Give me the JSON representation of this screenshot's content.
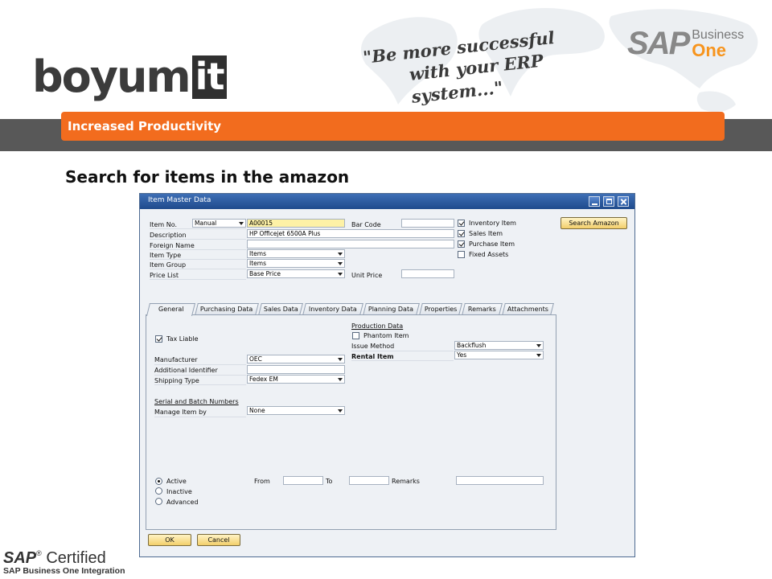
{
  "branding": {
    "logo_text": "boyum",
    "logo_box_text": "it",
    "slogan_line1": "\"Be more successful",
    "slogan_line2": "with your ERP system...\"",
    "sap_logo_text": "SAP",
    "sap_business": "Business",
    "sap_one": "One",
    "certified_line1": "SAP",
    "certified_line1b": "Certified",
    "certified_line2": "SAP Business One Integration"
  },
  "header": {
    "band_title": "Increased Productivity",
    "slide_heading": "Search for items in the amazon"
  },
  "window": {
    "title": "Item Master Data",
    "labels": {
      "item_no": "Item No.",
      "description": "Description",
      "foreign_name": "Foreign Name",
      "item_type": "Item Type",
      "item_group": "Item Group",
      "price_list": "Price List",
      "bar_code": "Bar Code",
      "unit_price": "Unit Price"
    },
    "values": {
      "numbering": "Manual",
      "item_no": "A00015",
      "description": "HP Officejet 6500A Plus",
      "foreign_name": "",
      "item_type": "Items",
      "item_group": "Items",
      "price_list": "Base Price",
      "bar_code": "",
      "unit_price": ""
    },
    "flags": [
      {
        "label": "Inventory Item",
        "checked": true
      },
      {
        "label": "Sales Item",
        "checked": true
      },
      {
        "label": "Purchase Item",
        "checked": true
      },
      {
        "label": "Fixed Assets",
        "checked": false
      }
    ],
    "search_button": "Search Amazon",
    "tabs": [
      "General",
      "Purchasing Data",
      "Sales Data",
      "Inventory Data",
      "Planning Data",
      "Properties",
      "Remarks",
      "Attachments"
    ],
    "active_tab": "General",
    "general": {
      "tax_liable": "Tax Liable",
      "manufacturer_label": "Manufacturer",
      "manufacturer": "OEC",
      "additional_identifier_label": "Additional Identifier",
      "additional_identifier": "",
      "shipping_type_label": "Shipping Type",
      "shipping_type": "Fedex EM",
      "serial_batch_heading": "Serial and Batch Numbers",
      "manage_item_by_label": "Manage Item by",
      "manage_item_by": "None",
      "production_heading": "Production Data",
      "phantom_item": "Phantom Item",
      "issue_method_label": "Issue Method",
      "issue_method": "Backflush",
      "rental_item_label": "Rental Item",
      "rental_item": "Yes",
      "status_options": [
        "Active",
        "Inactive",
        "Advanced"
      ],
      "status_selected": "Active",
      "from_label": "From",
      "to_label": "To",
      "remarks_label": "Remarks",
      "from": "",
      "to": "",
      "remarks": ""
    },
    "ok_button": "OK",
    "cancel_button": "Cancel"
  },
  "colors": {
    "orange_band": "#f26c1e",
    "dark_band": "#585858",
    "title_bar": "#2a5aa3",
    "item_no_highlight": "#fdf1a6"
  }
}
